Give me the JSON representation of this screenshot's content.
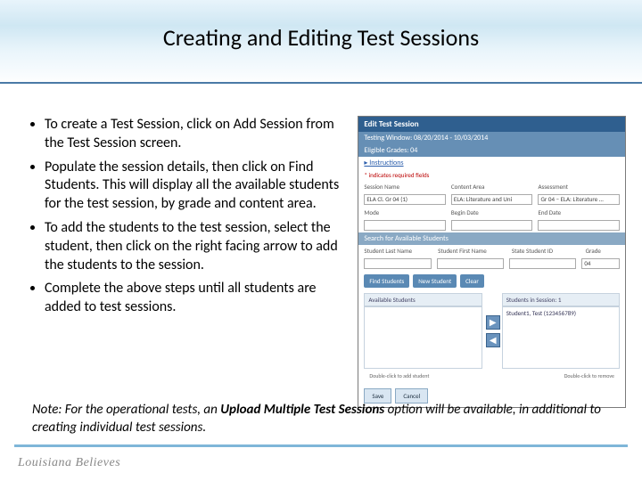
{
  "title": "Creating and Editing Test Sessions",
  "bullet1": "To create a Test Session, click on Add Session from the Test Session screen.",
  "bullet2": "Populate the session details, then click on Find Students.  This will display all the available students for the test session, by grade and content area.",
  "bullet3": "To add the students to the test session, select the student, then click on the right facing arrow to add the students to the session.",
  "bullet4": "Complete the above steps until all students are added to test sessions.",
  "note_prefix": "Note:  For the operational tests, an ",
  "note_bold": "Upload Multiple Test Sessions",
  "note_suffix": " option will be available, in additional to creating individual test sessions.",
  "footer_brand": "Louisiana Believes",
  "mock": {
    "win_title": "Edit Test Session",
    "testing_window": "Testing Window: 08/20/2014 - 10/03/2014",
    "eligible": "Eligible Grades: 04",
    "instructions": "▸ Instructions",
    "required": "* indicates required fields",
    "lbl_session_name": "Session Name",
    "val_session_name": "ELA Cl. Gr 04 (1)",
    "lbl_mode": "Mode",
    "lbl_content": "Content Area",
    "val_content": "ELA: Literature and Uni",
    "lbl_assessment": "Assessment",
    "val_assessment": "Gr 04 – ELA: Literature …",
    "lbl_begin": "Begin Date",
    "lbl_end": "End Date",
    "search_label": "Search for Available Students",
    "s_last": "Student Last Name",
    "s_first": "Student First Name",
    "s_id": "State Student ID",
    "s_grade": "Grade",
    "s_grade_val": "04",
    "btn_find": "Find Students",
    "btn_new": "New Student",
    "btn_clear": "Clear",
    "pane_avail": "Available Students",
    "pane_sess": "Students in Session: 1",
    "student": "Student1, Test (123456789)",
    "hint_left": "Double-click to add student",
    "hint_right": "Double-click to remove",
    "btn_save": "Save",
    "btn_cancel": "Cancel",
    "arrow_r": "▶",
    "arrow_l": "◀"
  }
}
